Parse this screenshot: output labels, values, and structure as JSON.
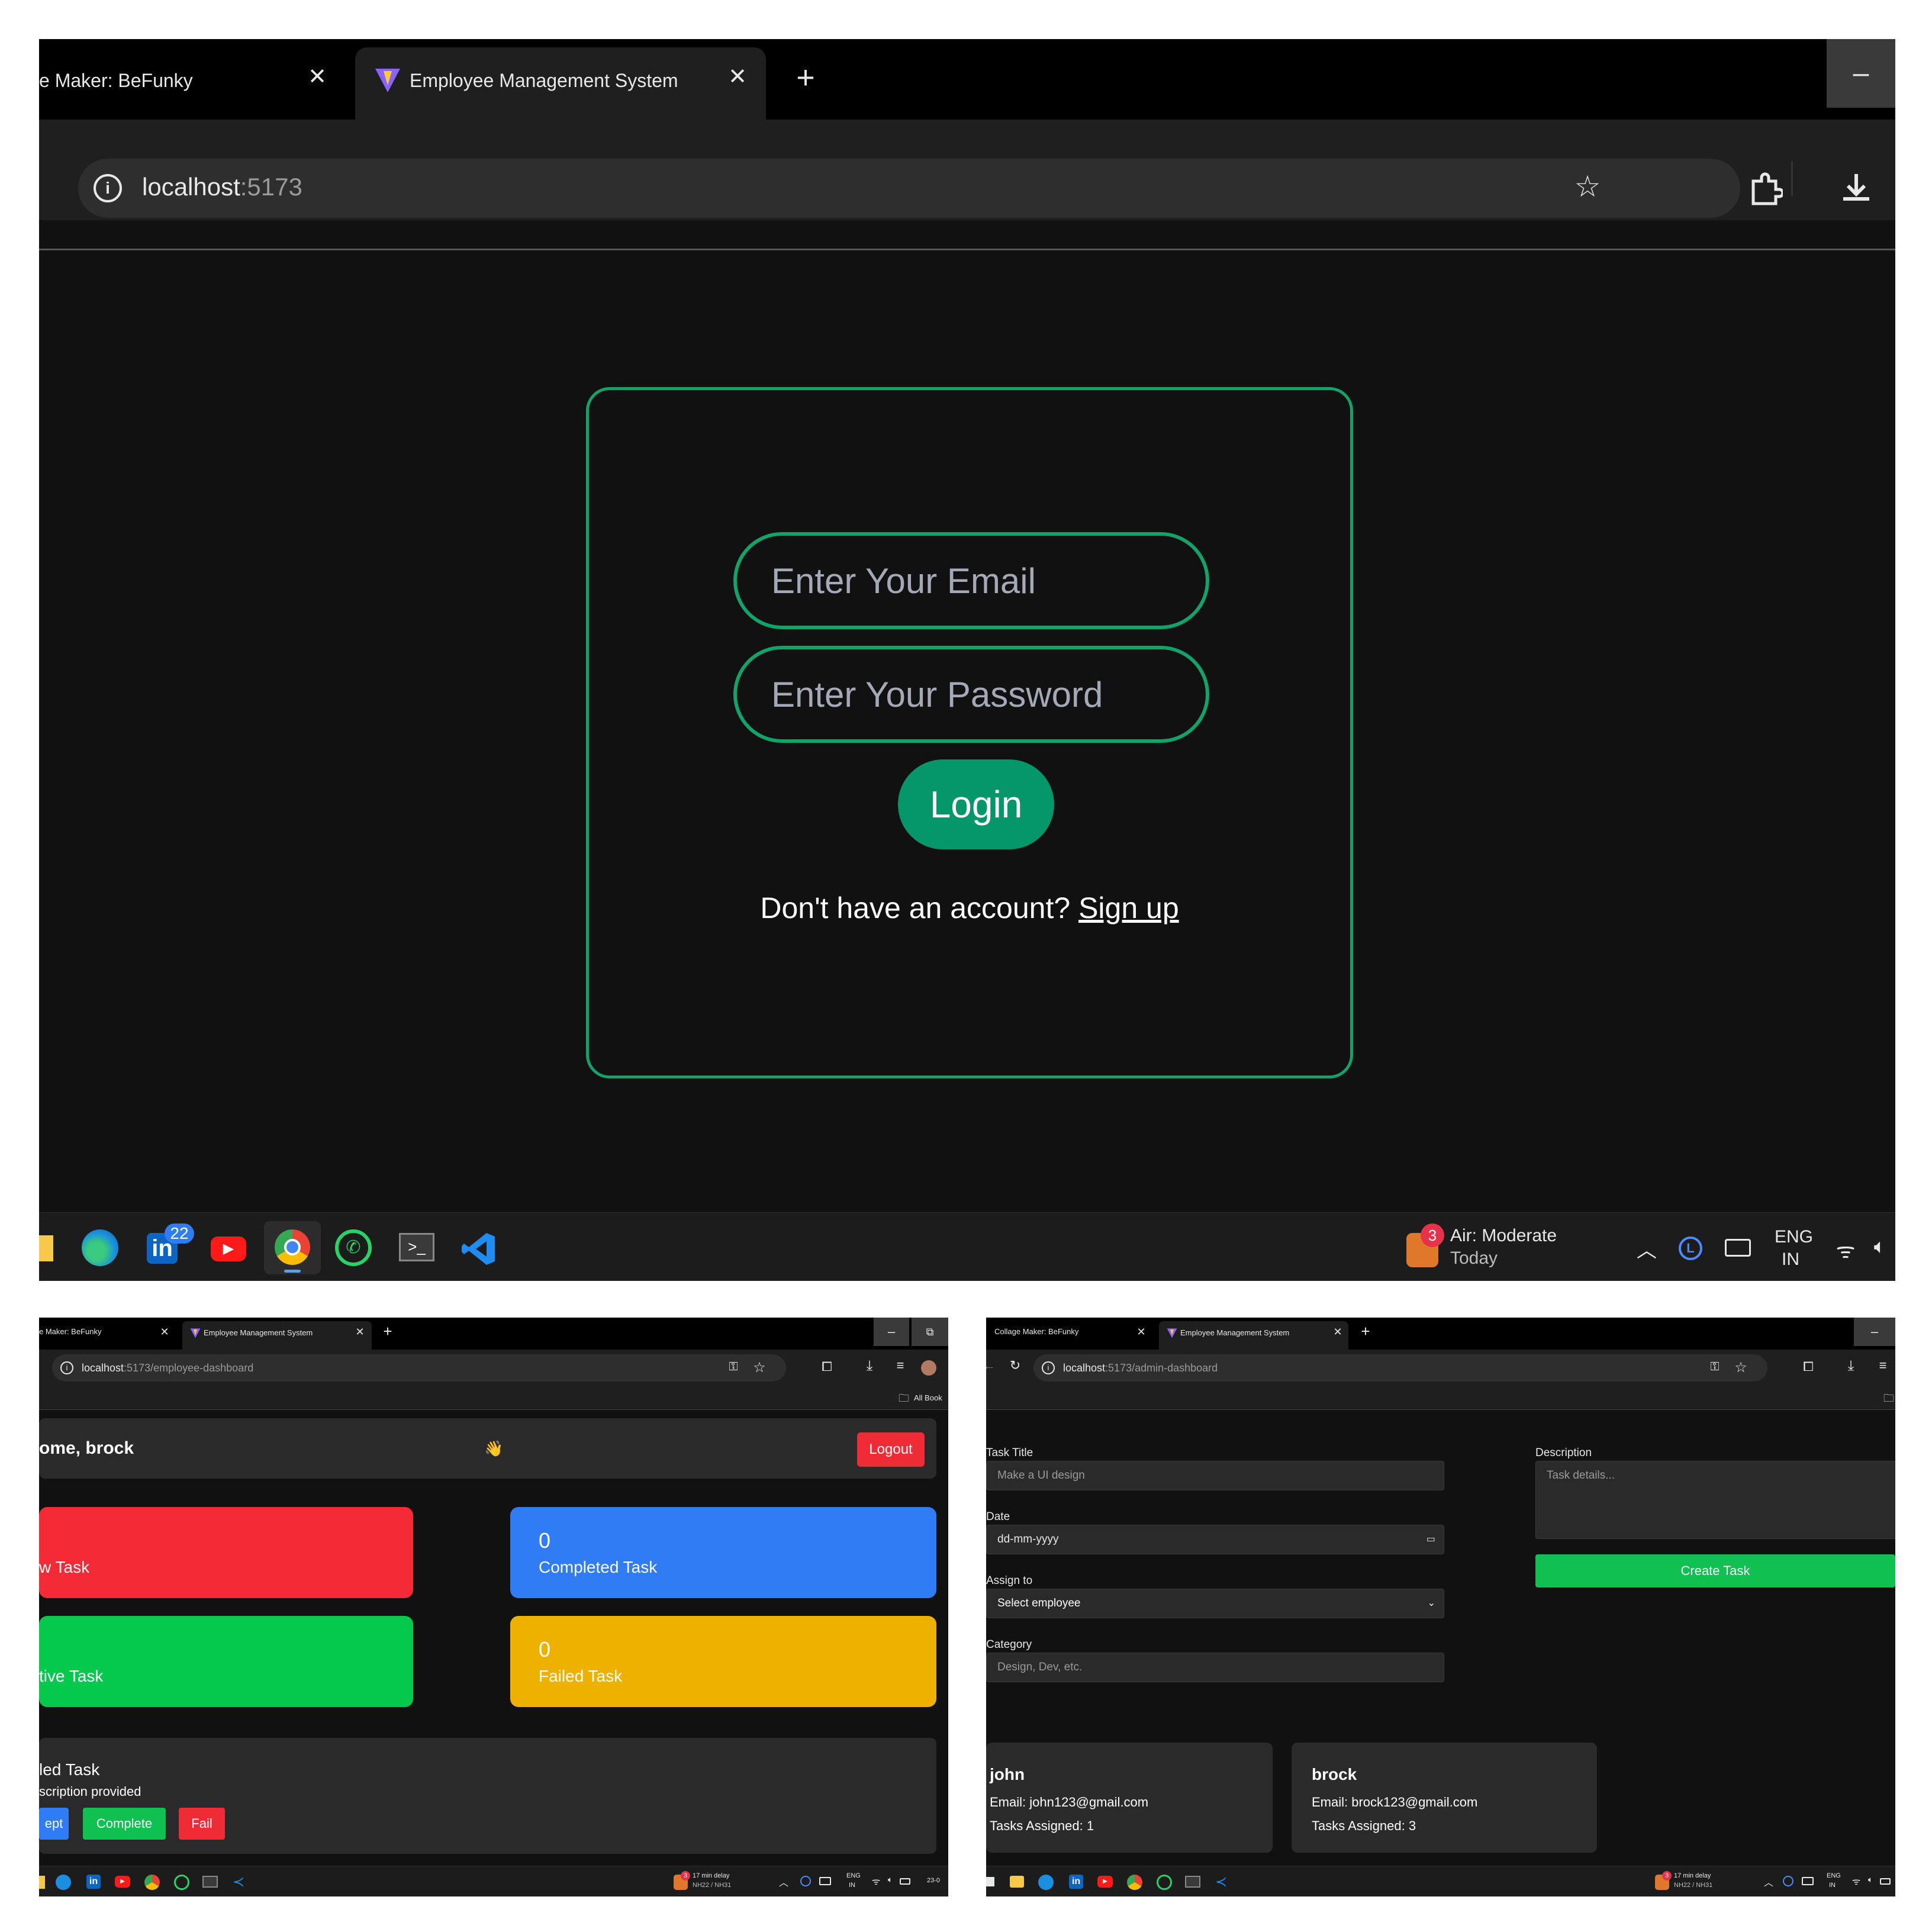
{
  "login_window": {
    "tabs": [
      {
        "label": "e Maker: BeFunky",
        "active": false
      },
      {
        "label": "Employee Management System",
        "active": true
      }
    ],
    "new_tab": "+",
    "minimize": "–",
    "url_host": "localhost",
    "url_rest": ":5173",
    "email_placeholder": "Enter Your Email",
    "password_placeholder": "Enter Your Password",
    "login_label": "Login",
    "signup_prompt": "Don't have an account?",
    "signup_link": "Sign up",
    "taskbar": {
      "linkedin_badge": "22",
      "weather_badge": "3",
      "weather_title": "Air: Moderate",
      "weather_sub": "Today",
      "lang_1": "ENG",
      "lang_2": "IN"
    }
  },
  "employee_window": {
    "tabs": [
      {
        "label": "e Maker: BeFunky"
      },
      {
        "label": "Employee Management System"
      }
    ],
    "url_host": "localhost",
    "url_rest": ":5173/employee-dashboard",
    "bookmarks_label": "All Book",
    "greeting": "ome, brock",
    "wave": "👋",
    "logout_label": "Logout",
    "stats": [
      {
        "number": "",
        "label": "w Task",
        "color": "#f42b36"
      },
      {
        "number": "0",
        "label": "Completed Task",
        "color": "#2f7cf5"
      },
      {
        "number": "",
        "label": "tive Task",
        "color": "#05c94d"
      },
      {
        "number": "0",
        "label": "Failed Task",
        "color": "#efb100"
      }
    ],
    "task": {
      "title": "led Task",
      "description": "scription provided",
      "accept_label": "ept",
      "complete_label": "Complete",
      "fail_label": "Fail"
    },
    "taskbar": {
      "weather_badge": "3",
      "weather_title": "17 min delay",
      "weather_sub": "NH22 / NH31",
      "lang_1": "ENG",
      "lang_2": "IN",
      "clock": "23-0"
    }
  },
  "admin_window": {
    "tabs": [
      {
        "label": "Collage Maker: BeFunky"
      },
      {
        "label": "Employee Management System"
      }
    ],
    "url_host": "localhost",
    "url_rest": ":5173/admin-dashboard",
    "form": {
      "title_label": "Task Title",
      "title_placeholder": "Make a UI design",
      "date_label": "Date",
      "date_placeholder": "dd-mm-yyyy",
      "assign_label": "Assign to",
      "assign_value": "Select employee",
      "category_label": "Category",
      "category_placeholder": "Design, Dev, etc.",
      "description_label": "Description",
      "description_placeholder": "Task details...",
      "create_label": "Create Task"
    },
    "employees": [
      {
        "name": "john",
        "email": "Email: john123@gmail.com",
        "tasks": "Tasks Assigned: 1"
      },
      {
        "name": "brock",
        "email": "Email: brock123@gmail.com",
        "tasks": "Tasks Assigned: 3"
      }
    ],
    "taskbar": {
      "weather_badge": "3",
      "weather_title": "17 min delay",
      "weather_sub": "NH22 / NH31",
      "lang_1": "ENG",
      "lang_2": "IN"
    }
  },
  "colors": {
    "accent_green": "#10a36a",
    "login_button": "#059669",
    "logout_red": "#ef2b36",
    "create_green": "#10c050",
    "accept_blue": "#2f7cf5",
    "complete_green": "#10c050",
    "fail_red": "#ef2b36"
  },
  "icons": [
    "info-icon",
    "star-icon",
    "extensions-icon",
    "download-icon",
    "close-icon",
    "plus-icon",
    "minimize-icon",
    "vite-icon",
    "reload-icon",
    "key-icon",
    "calendar-icon",
    "chevron-down-icon",
    "folder-icon",
    "edge-icon",
    "linkedin-icon",
    "youtube-icon",
    "chrome-icon",
    "whatsapp-icon",
    "terminal-icon",
    "vscode-icon",
    "weather-icon",
    "chevron-up-icon",
    "clock-app-icon",
    "keyboard-icon",
    "wifi-icon",
    "volume-icon"
  ]
}
